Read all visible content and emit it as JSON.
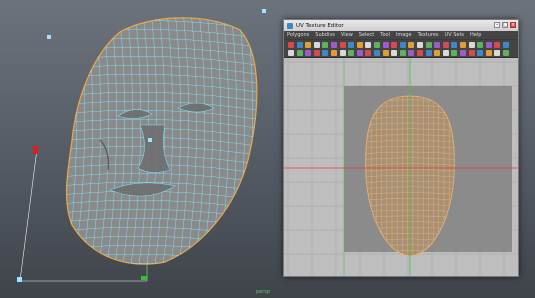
{
  "viewport": {
    "hud_label": "persp"
  },
  "uv_editor": {
    "title": "UV Texture Editor",
    "menu": [
      "Polygons",
      "Subdivs",
      "View",
      "Select",
      "Tool",
      "Image",
      "Textures",
      "UV Sets",
      "Help"
    ],
    "colors": {
      "wire": "#f3b46a",
      "u_axis": "#e03c3c",
      "v_axis": "#4fc04f",
      "canvas": "#bebebe",
      "uv_tile": "#8b8b8b"
    }
  },
  "colors": {
    "mesh_wire": "#7fe3ff",
    "mesh_surface": "#8a8a8a",
    "border_edge": "#f1a542"
  }
}
